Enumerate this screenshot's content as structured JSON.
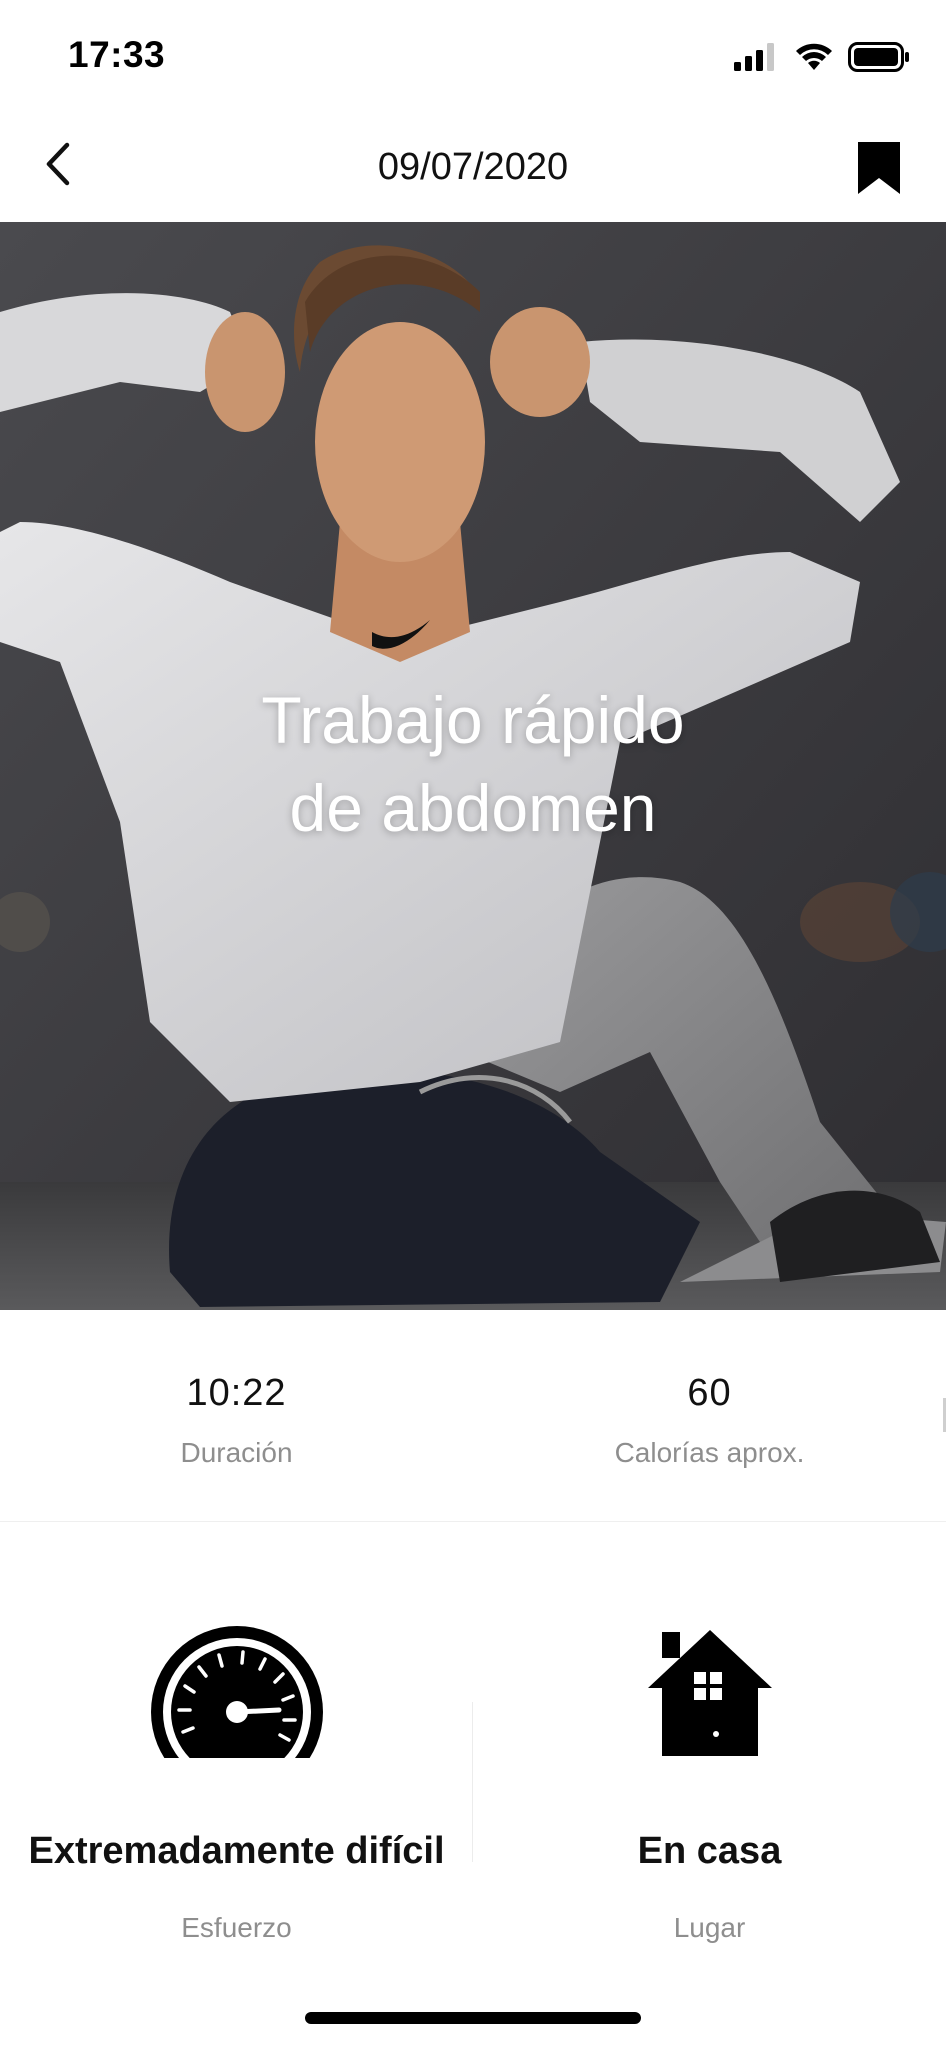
{
  "status_bar": {
    "time": "17:33"
  },
  "nav": {
    "title": "09/07/2020"
  },
  "hero": {
    "title_line1": "Trabajo rápido",
    "title_line2": "de abdomen"
  },
  "stats": [
    {
      "value": "10:22",
      "label": "Duración"
    },
    {
      "value": "60",
      "label": "Calorías aprox."
    }
  ],
  "details": [
    {
      "icon": "speedometer-icon",
      "value": "Extremadamente difícil",
      "label": "Esfuerzo"
    },
    {
      "icon": "house-icon",
      "value": "En casa",
      "label": "Lugar"
    }
  ],
  "colors": {
    "background": "#ffffff",
    "text": "#111111",
    "secondary_text": "#8e8e8e"
  }
}
